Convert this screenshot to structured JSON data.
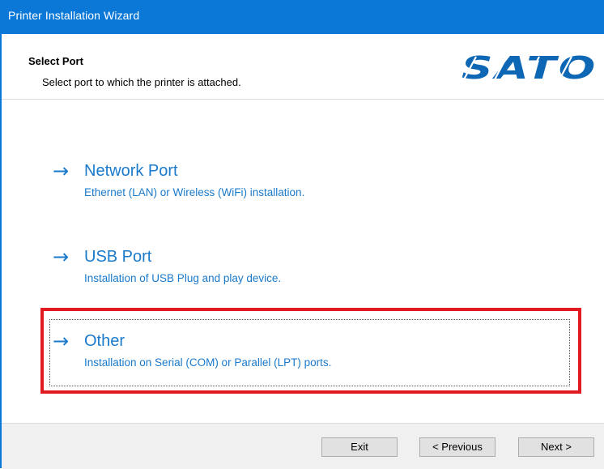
{
  "window": {
    "title": "Printer Installation Wizard",
    "accent_color": "#0b78d7"
  },
  "header": {
    "heading": "Select Port",
    "subheading": "Select port to which the printer is attached.",
    "logo_text": "SATO"
  },
  "options": [
    {
      "label": "Network Port",
      "description": "Ethernet (LAN) or Wireless (WiFi) installation.",
      "icon": "arrow-right-icon"
    },
    {
      "label": "USB Port",
      "description": "Installation of USB Plug and play device.",
      "icon": "arrow-right-icon"
    },
    {
      "label": "Other",
      "description": "Installation on Serial (COM) or Parallel (LPT) ports.",
      "icon": "arrow-right-icon",
      "highlighted": true
    }
  ],
  "buttons": {
    "exit": "Exit",
    "previous": "< Previous",
    "next": "Next >"
  },
  "colors": {
    "link": "#1a7acb",
    "highlight": "#e11b22",
    "logo": "#0d67b5"
  }
}
